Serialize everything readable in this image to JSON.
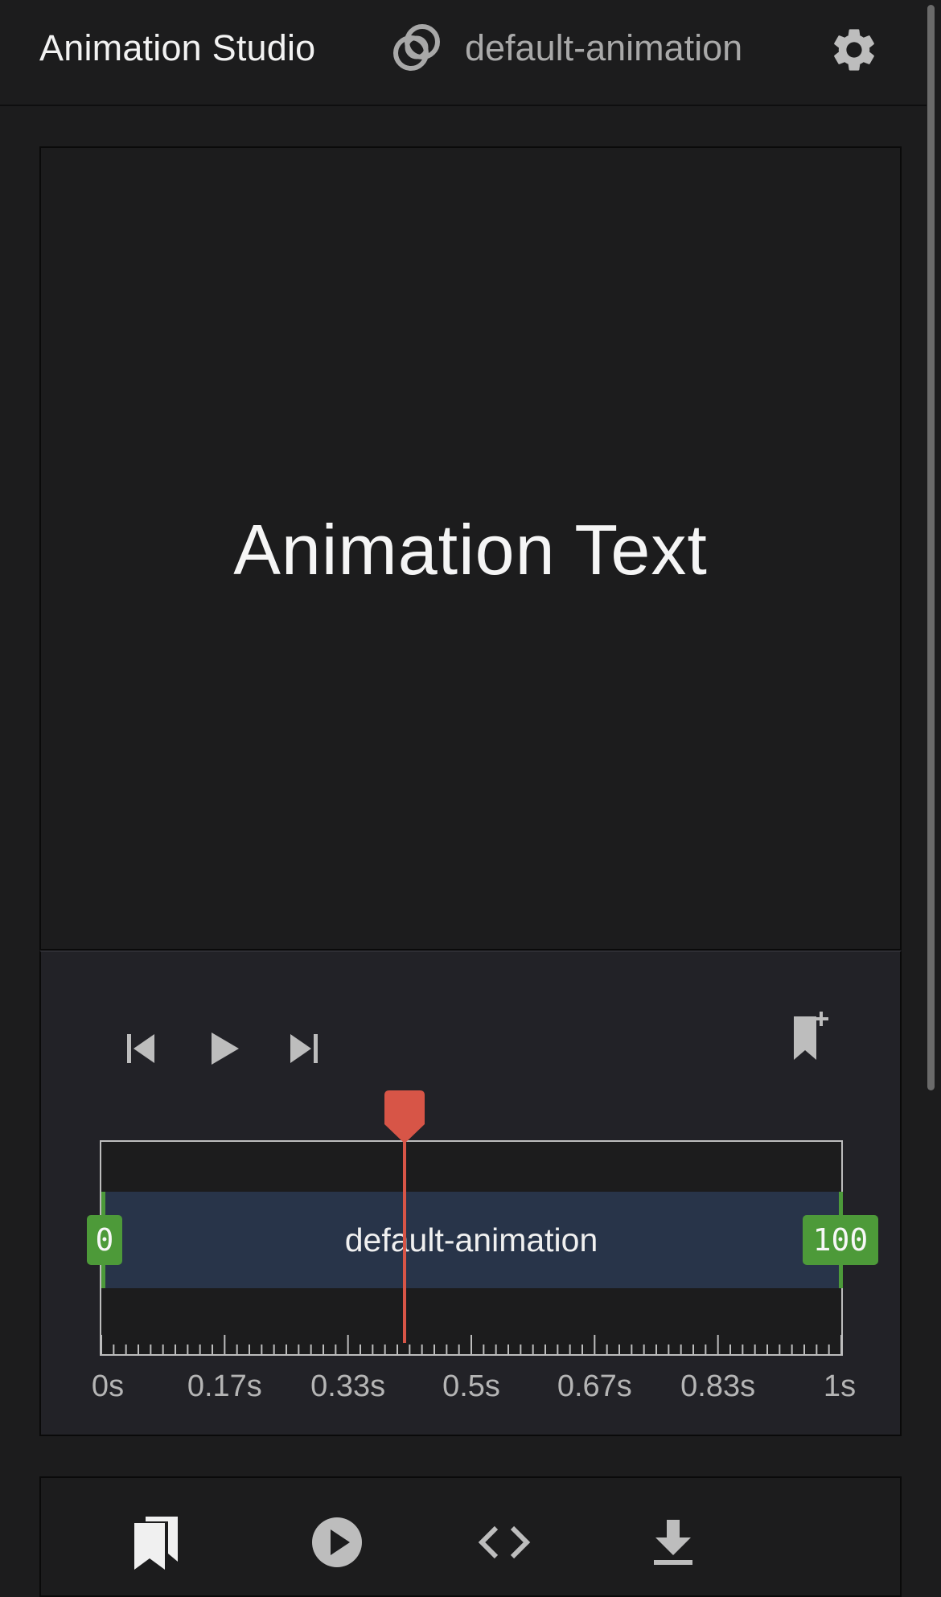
{
  "header": {
    "app_title": "Animation Studio",
    "animation_name": "default-animation",
    "link_icon": "linked-rings-icon",
    "settings_icon": "gear-icon"
  },
  "preview": {
    "text": "Animation Text"
  },
  "player": {
    "controls": [
      {
        "name": "skip-to-start-icon"
      },
      {
        "name": "play-icon"
      },
      {
        "name": "skip-to-end-icon"
      }
    ],
    "add_bookmark_icon": "bookmark-add-icon",
    "playhead_position": 0.41,
    "accent_color": "#d75547"
  },
  "timeline": {
    "track_label": "default-animation",
    "start_keyframe": "0",
    "end_keyframe": "100",
    "tick_labels": [
      "0s",
      "0.17s",
      "0.33s",
      "0.5s",
      "0.67s",
      "0.83s",
      "1s"
    ],
    "track_color": "#283449",
    "keyframe_color": "#4d9a39"
  },
  "bottom_toolbar": {
    "items": [
      {
        "name": "library-icon"
      },
      {
        "name": "play-circle-icon"
      },
      {
        "name": "code-icon"
      },
      {
        "name": "download-icon"
      }
    ]
  }
}
